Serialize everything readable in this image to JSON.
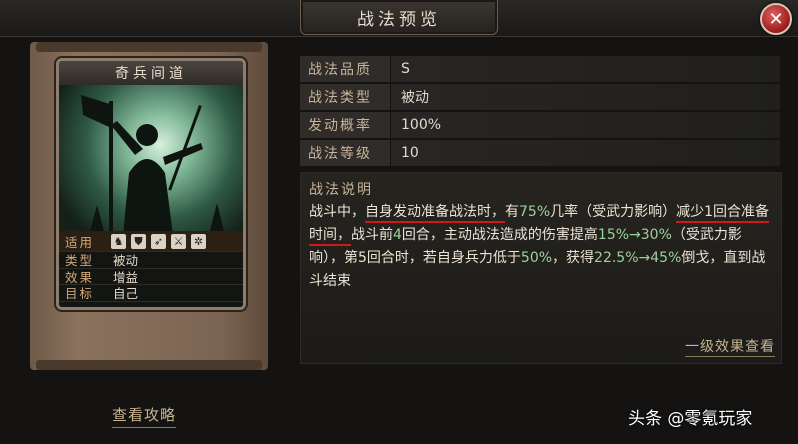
{
  "window": {
    "title": "战法预览"
  },
  "card": {
    "name": "奇兵间道",
    "stats": [
      {
        "key": "适用",
        "value": ""
      },
      {
        "key": "类型",
        "value": "被动"
      },
      {
        "key": "效果",
        "value": "增益"
      },
      {
        "key": "目标",
        "value": "自己"
      }
    ],
    "suit_icons": [
      "cavalry-icon",
      "shield-icon",
      "bow-icon",
      "spear-icon",
      "wheel-icon"
    ]
  },
  "info": [
    {
      "key": "战法品质",
      "value": "S"
    },
    {
      "key": "战法类型",
      "value": "被动"
    },
    {
      "key": "发动概率",
      "value": "100%"
    },
    {
      "key": "战法等级",
      "value": "10"
    }
  ],
  "description": {
    "label": "战法说明",
    "segments": [
      {
        "t": "战斗中，"
      },
      {
        "t": "自身发动准备战法时，",
        "u": true
      },
      {
        "t": "有"
      },
      {
        "t": "75%",
        "h": true
      },
      {
        "t": "几率（受武力影响）"
      },
      {
        "t": "减少1回合准备时间，",
        "u": true
      },
      {
        "t": "战斗前"
      },
      {
        "t": "4",
        "h": true
      },
      {
        "t": "回合，主动战法造成的伤害提高"
      },
      {
        "t": "15%→30%",
        "h": true
      },
      {
        "t": "（受武力影响），第5回合时，若自身兵力低于"
      },
      {
        "t": "50%",
        "h": true
      },
      {
        "t": "，获得"
      },
      {
        "t": "22.5%→45%",
        "h": true
      },
      {
        "t": "倒戈，直到战斗结束"
      }
    ],
    "level_link": "一级效果查看"
  },
  "strategy_link": "查看攻略",
  "watermark": "头条 @零氪玩家",
  "colors": {
    "highlight": "#9ed19a",
    "underline": "#d01a1a",
    "close": "#9a1b1b"
  }
}
